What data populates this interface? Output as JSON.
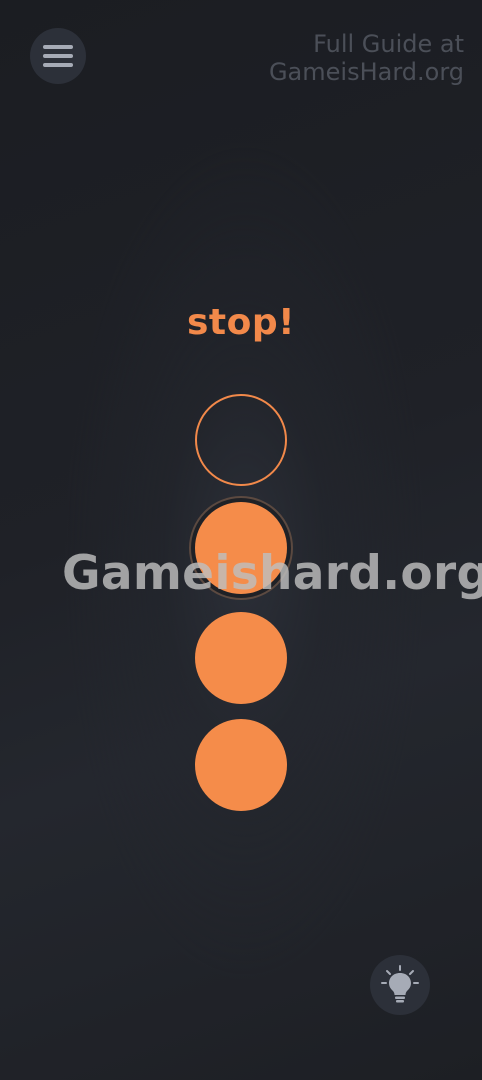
{
  "header": {
    "menu_icon": "hamburger-menu-icon",
    "watermark_line1": "Full Guide at",
    "watermark_line2": "GameisHard.org"
  },
  "puzzle": {
    "prompt": "stop!",
    "circles": [
      {
        "state": "empty"
      },
      {
        "state": "filled",
        "selected": true
      },
      {
        "state": "filled"
      },
      {
        "state": "filled"
      }
    ]
  },
  "overlay": {
    "watermark": "Gameishard.org"
  },
  "footer": {
    "hint_icon": "lightbulb-icon"
  },
  "colors": {
    "accent": "#f58c4a",
    "background": "#1f2127",
    "button_bg": "#2c3039",
    "icon": "#a6abb6"
  }
}
